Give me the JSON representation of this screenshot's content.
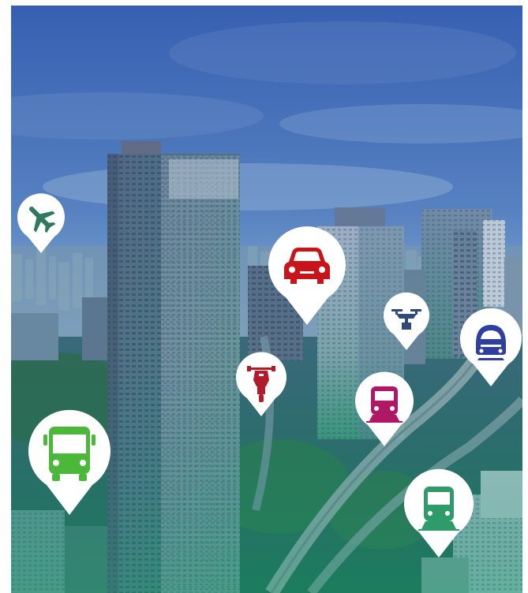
{
  "pins": [
    {
      "id": "plane",
      "icon": "airplane-icon",
      "color": "#2f7a5f"
    },
    {
      "id": "car",
      "icon": "car-icon",
      "color": "#c8151b"
    },
    {
      "id": "drone",
      "icon": "drone-icon",
      "color": "#2d4a78"
    },
    {
      "id": "bullet-train",
      "icon": "bullet-train-icon",
      "color": "#2f3fa0"
    },
    {
      "id": "scooter",
      "icon": "scooter-icon",
      "color": "#b01c2a"
    },
    {
      "id": "tram",
      "icon": "tram-icon",
      "color": "#b01865"
    },
    {
      "id": "bus",
      "icon": "bus-icon",
      "color": "#4cb83a"
    },
    {
      "id": "train",
      "icon": "train-icon",
      "color": "#2f9a6a"
    }
  ],
  "colors": {
    "sky_top": "#3c6fc0",
    "sky_bottom": "#8eb6d8",
    "city_tint": "#2f8f80",
    "pin_fill": "#ffffff"
  }
}
